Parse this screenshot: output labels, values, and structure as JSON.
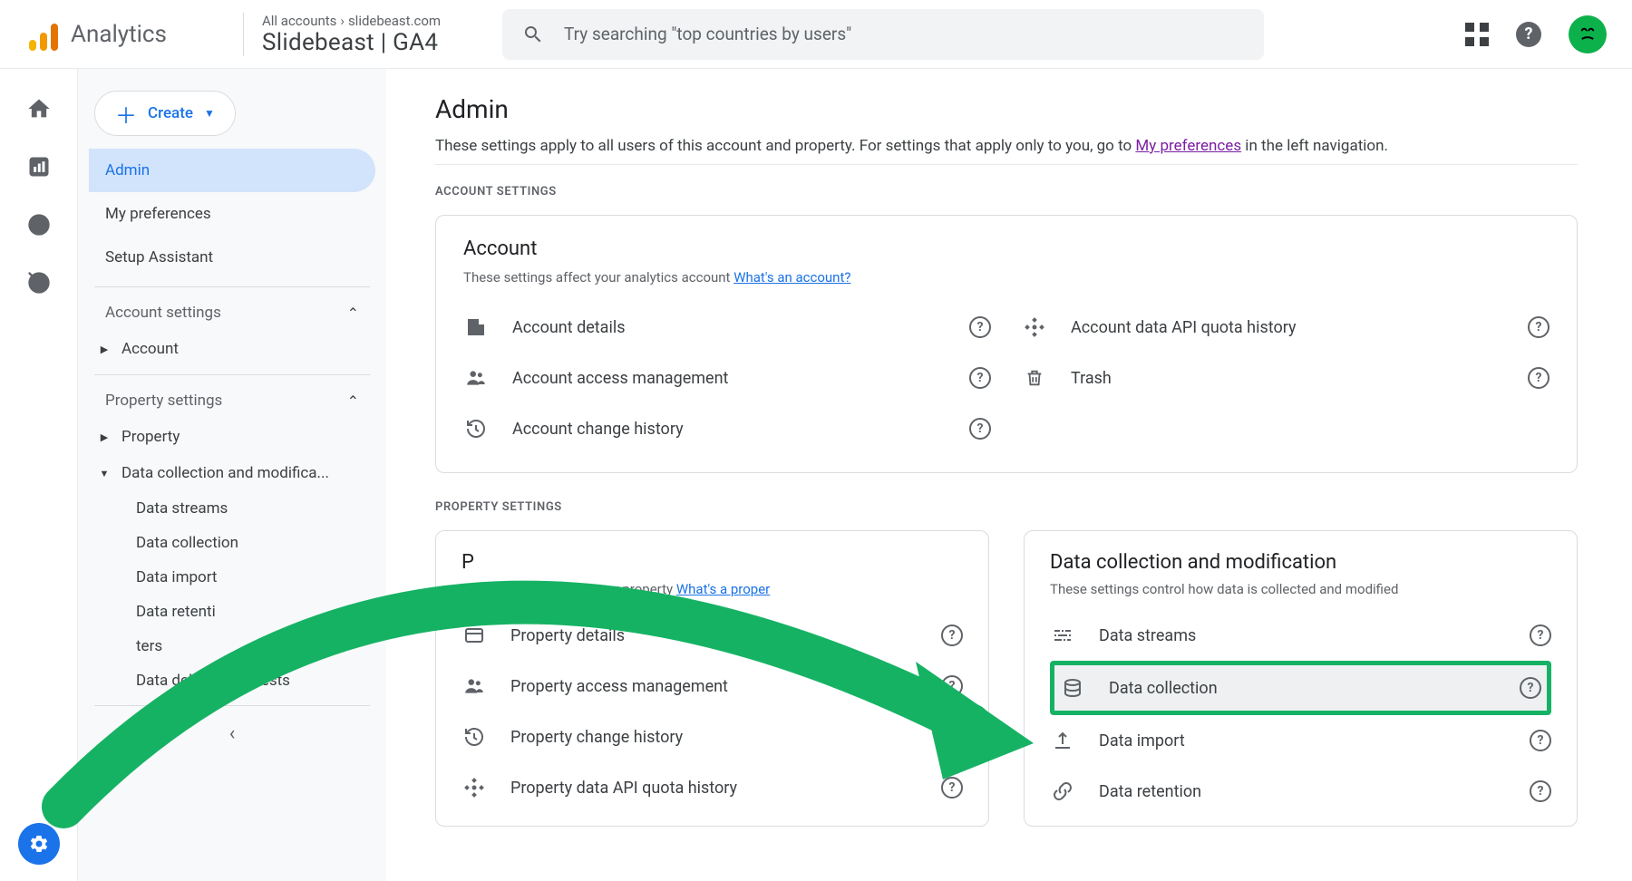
{
  "header": {
    "product": "Analytics",
    "breadcrumb_top_left": "All accounts",
    "breadcrumb_top_right": "slidebeast.com",
    "breadcrumb_bottom": "Slidebeast  | GA4",
    "search_placeholder": "Try searching \"top countries by users\""
  },
  "sidebar": {
    "create": "Create",
    "items": [
      "Admin",
      "My preferences",
      "Setup Assistant"
    ],
    "account_section": "Account settings",
    "account_sub": "Account",
    "property_section": "Property settings",
    "property_sub": "Property",
    "data_sub": "Data collection and modifica...",
    "data_children": [
      "Data streams",
      "Data collection",
      "Data import",
      "Data retenti",
      "            ters",
      "Data deletion requests"
    ]
  },
  "main": {
    "title": "Admin",
    "desc_pre": "These settings apply to all users of this account and property. For settings that apply only to you, go to ",
    "desc_link": "My preferences",
    "desc_post": " in the left navigation.",
    "account_label": "ACCOUNT SETTINGS",
    "property_label": "PROPERTY SETTINGS",
    "account_card": {
      "title": "Account",
      "sub_pre": "These settings affect your analytics account ",
      "sub_link": "What's an account?",
      "left": [
        "Account details",
        "Account access management",
        "Account change history"
      ],
      "right": [
        "Account data API quota history",
        "Trash"
      ]
    },
    "property_card": {
      "title": "P",
      "sub_pre": "These settings affect your property ",
      "sub_link": "What's a proper",
      "items": [
        "Property details",
        "Property access management",
        "Property change history",
        "Property data API quota history"
      ]
    },
    "datacol_card": {
      "title": "Data collection and modification",
      "sub": "These settings control how data is collected and modified",
      "items": [
        "Data streams",
        "Data collection",
        "Data import",
        "Data retention"
      ]
    }
  }
}
